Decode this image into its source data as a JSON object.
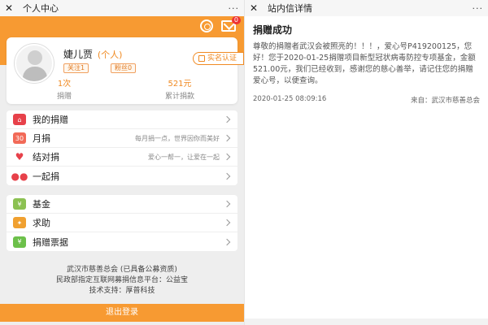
{
  "left": {
    "topbar": {
      "close_glyph": "✕",
      "title": "个人中心",
      "more": "···"
    },
    "mail_badge": "0",
    "profile": {
      "name": "婕儿贾",
      "type": "(个人)",
      "follow": "关注1",
      "fans": "粉丝0",
      "verify": "实名认证"
    },
    "stats": [
      {
        "value": "1次",
        "label": "捐赠"
      },
      {
        "value": "521元",
        "label": "累计捐款"
      }
    ],
    "menu1": [
      {
        "label": "我的捐赠",
        "sub": "",
        "icon": "home-icon"
      },
      {
        "label": "月捐",
        "sub": "每月捐一点，世界因你而美好",
        "icon": "calendar-icon",
        "icon_text": "30"
      },
      {
        "label": "结对捐",
        "sub": "爱心一帮一，让爱在一起",
        "icon": "heart-icon"
      },
      {
        "label": "一起捐",
        "sub": "",
        "icon": "people-icon"
      }
    ],
    "menu2": [
      {
        "label": "基金",
        "icon": "yen-icon",
        "icon_text": "¥"
      },
      {
        "label": "求助",
        "icon": "help-icon",
        "icon_text": "✦"
      },
      {
        "label": "捐赠票据",
        "icon": "receipt-icon",
        "icon_text": "¥"
      }
    ],
    "footer": {
      "line1": "武汉市慈善总会 (已具备公募资质)",
      "line2": "民政部指定互联网募捐信息平台：公益宝",
      "line3": "技术支持：厚普科技"
    },
    "logout": "退出登录"
  },
  "right": {
    "topbar": {
      "close_glyph": "✕",
      "title": "站内信详情",
      "more": "···"
    },
    "message": {
      "title": "捐赠成功",
      "body": "尊敬的捐赠者武汉会被照亮的！！！，爱心号P419200125，您好！您于2020-01-25捐赠项目新型冠状病毒防控专项基金，金额521.00元，我们已经收到，感谢您的慈心善举，请记住您的捐赠爱心号，以便查询。",
      "date": "2020-01-25 08:09:16",
      "source": "来自：武汉市慈善总会"
    }
  },
  "colors": {
    "accent": "#f79a32",
    "accent_text": "#f08a22",
    "red_icon": "#e7414a",
    "green_icon": "#8cc152"
  }
}
